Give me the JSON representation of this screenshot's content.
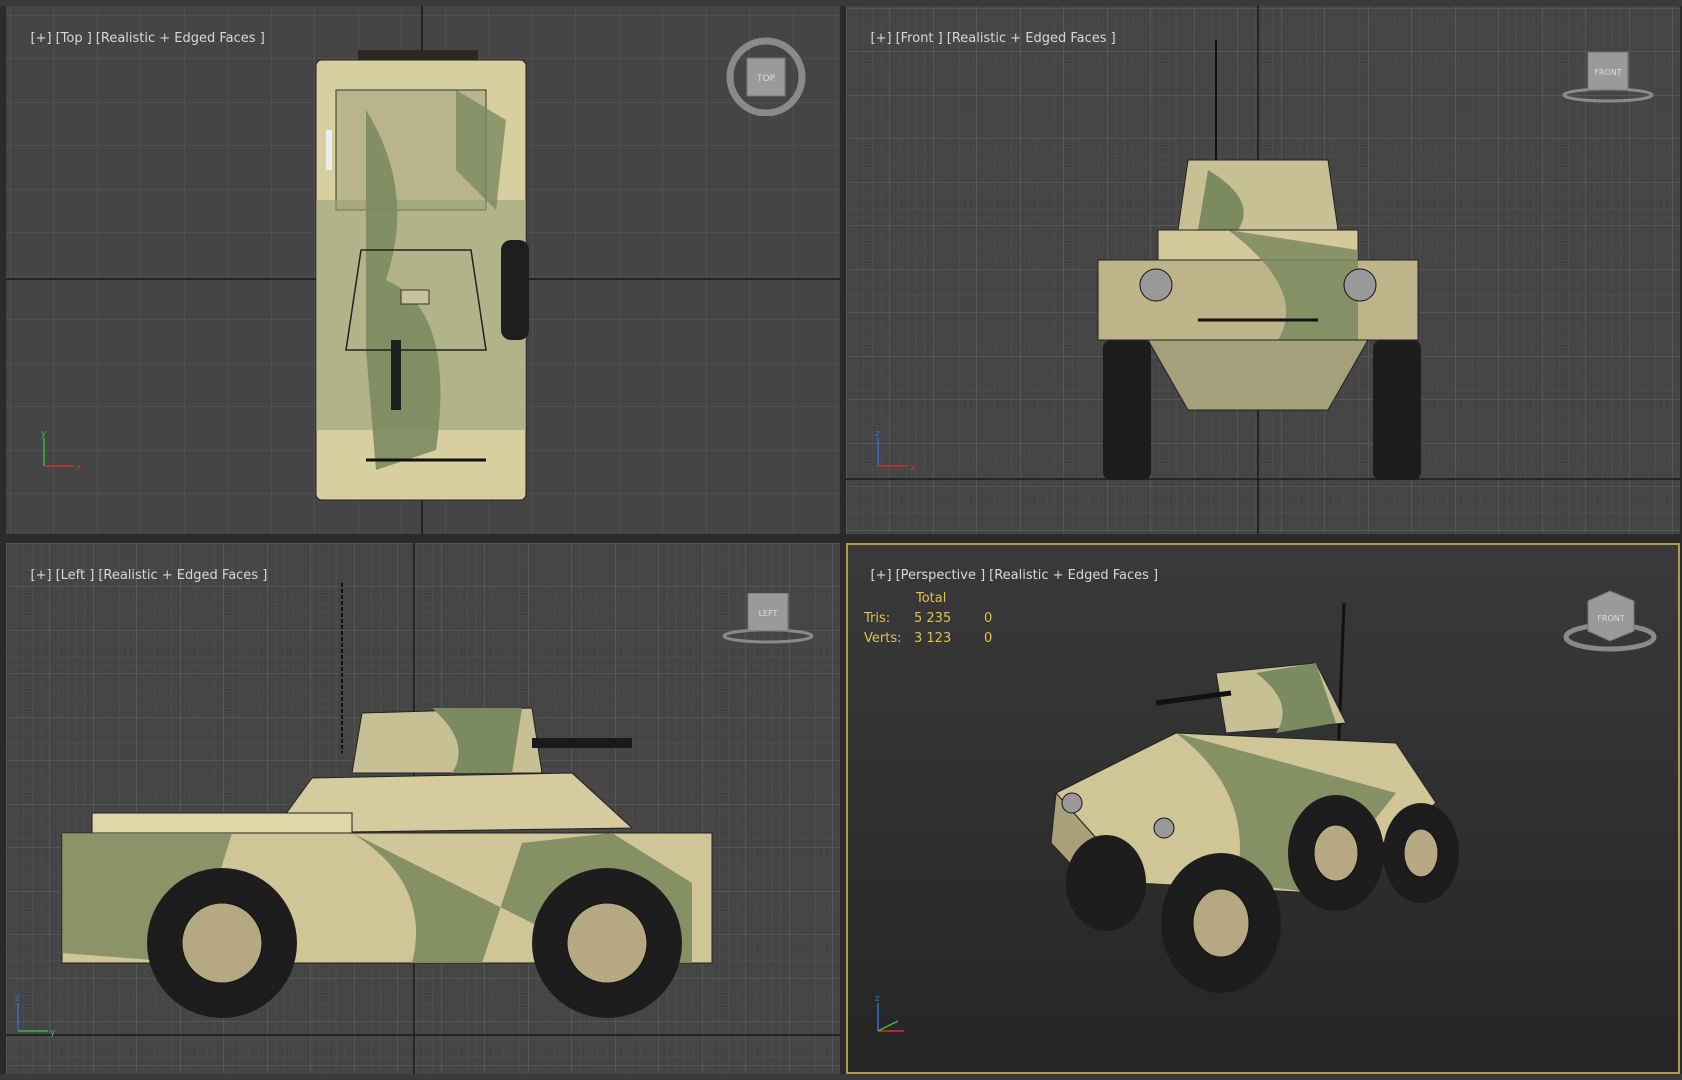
{
  "viewports": {
    "top": {
      "plus": "[+]",
      "view": "[Top ]",
      "shading": "[Realistic + Edged Faces ]",
      "cube_label": "TOP"
    },
    "front": {
      "plus": "[+]",
      "view": "[Front ]",
      "shading": "[Realistic + Edged Faces ]",
      "cube_label": "FRONT"
    },
    "left": {
      "plus": "[+]",
      "view": "[Left ]",
      "shading": "[Realistic + Edged Faces ]",
      "cube_label": "LEFT"
    },
    "perspective": {
      "plus": "[+]",
      "view": "[Perspective ]",
      "shading": "[Realistic + Edged Faces ]",
      "cube_label": "FRONT"
    }
  },
  "stats": {
    "header": "Total",
    "tris_label": "Tris:",
    "tris_value": "5 235",
    "tris_selected": "0",
    "verts_label": "Verts:",
    "verts_value": "3 123",
    "verts_selected": "0"
  },
  "colors": {
    "viewport_bg": "#454545",
    "perspective_bg": "#2f2f2f",
    "active_border": "#b09a4a",
    "stats_text": "#e0c14a"
  },
  "icons": {
    "viewcube": "viewcube-icon",
    "axis_tripod": "axis-tripod-icon"
  }
}
